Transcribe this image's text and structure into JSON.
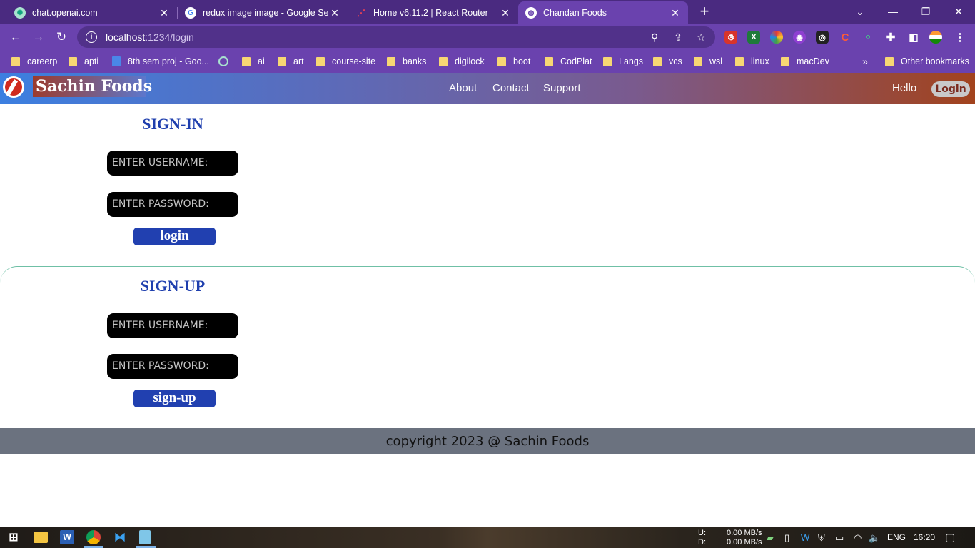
{
  "browser": {
    "tabs": [
      {
        "title": "chat.openai.com",
        "favicon": "openai-icon"
      },
      {
        "title": "redux image image - Google Sea",
        "favicon": "google-icon"
      },
      {
        "title": "Home v6.11.2 | React Router",
        "favicon": "react-router-icon"
      },
      {
        "title": "Chandan Foods",
        "favicon": "globe-icon",
        "active": true
      }
    ],
    "url_host": "localhost",
    "url_path": ":1234/login",
    "bookmarks": [
      "careerp",
      "apti",
      "8th sem proj - Goo...",
      "ai",
      "art",
      "course-site",
      "banks",
      "digilock",
      "boot",
      "CodPlat",
      "Langs",
      "vcs",
      "wsl",
      "linux",
      "macDev"
    ],
    "more_bookmarks": "»",
    "other_bookmarks": "Other bookmarks",
    "accent": "#6a42ae"
  },
  "app": {
    "brand": "Sachin Foods",
    "nav_links": [
      "About",
      "Contact",
      "Support"
    ],
    "greeting": "Hello",
    "login_button": "Login"
  },
  "signin": {
    "title": "SIGN-IN",
    "username_placeholder": "ENTER USERNAME:",
    "password_placeholder": "ENTER PASSWORD:",
    "button": "login"
  },
  "signup": {
    "title": "SIGN-UP",
    "username_placeholder": "ENTER USERNAME:",
    "password_placeholder": "ENTER PASSWORD:",
    "button": "sign-up"
  },
  "footer": {
    "text": "copyright 2023 @ Sachin Foods"
  },
  "taskbar": {
    "net_up_label": "U:",
    "net_down_label": "D:",
    "net_up": "0.00 MB/s",
    "net_down": "0.00 MB/s",
    "language": "ENG",
    "time": "16:20"
  }
}
